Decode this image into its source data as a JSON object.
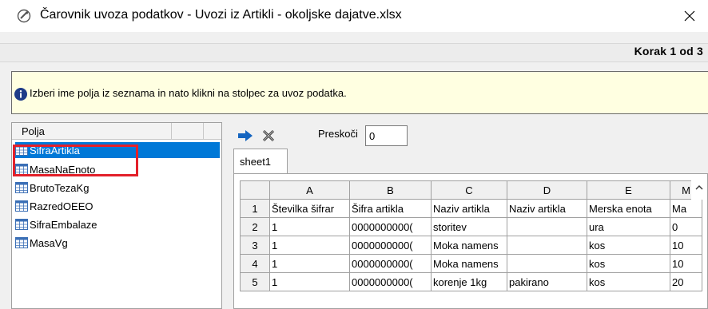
{
  "window": {
    "title": "Čarovnik uvoza podatkov - Uvozi iz Artikli - okoljske dajatve.xlsx",
    "app_icon": "wizard-icon",
    "close_icon": "close-icon"
  },
  "step": {
    "text": "Korak 1 od 3"
  },
  "hint": {
    "icon": "info-icon",
    "text": "Izberi ime polja iz seznama in nato klikni na stolpec za uvoz podatka."
  },
  "fields": {
    "header": "Polja",
    "selected_index": 0,
    "items": [
      {
        "label": "SifraArtikla"
      },
      {
        "label": "MasaNaEnoto"
      },
      {
        "label": "BrutoTezaKg"
      },
      {
        "label": "RazredOEEO"
      },
      {
        "label": "SifraEmbalaze"
      },
      {
        "label": "MasaVg"
      }
    ]
  },
  "toolbar": {
    "assign_icon": "arrow-right-icon",
    "clear_icon": "clear-x-icon",
    "skip_label": "Preskoči",
    "skip_value": "0"
  },
  "sheet": {
    "tab_label": "sheet1",
    "columns": [
      "A",
      "B",
      "C",
      "D",
      "E",
      "M"
    ],
    "rows": [
      {
        "num": "1",
        "cells": [
          "Številka šifrar",
          "Šifra artikla",
          "Naziv artikla",
          "Naziv artikla",
          "Merska enota",
          "Ma"
        ]
      },
      {
        "num": "2",
        "cells": [
          "1",
          "0000000000(",
          "storitev",
          "",
          "ura",
          "0"
        ]
      },
      {
        "num": "3",
        "cells": [
          "1",
          "0000000000(",
          "Moka namens",
          "",
          "kos",
          "10"
        ]
      },
      {
        "num": "4",
        "cells": [
          "1",
          "0000000000(",
          "Moka namens",
          "",
          "kos",
          "10"
        ]
      },
      {
        "num": "5",
        "cells": [
          "1",
          "0000000000(",
          "korenje 1kg",
          "pakirano",
          "kos",
          "20"
        ]
      }
    ]
  },
  "colors": {
    "accent": "#0078d7",
    "selection_outline": "#e3202a",
    "hint_background": "#ffffe1"
  }
}
